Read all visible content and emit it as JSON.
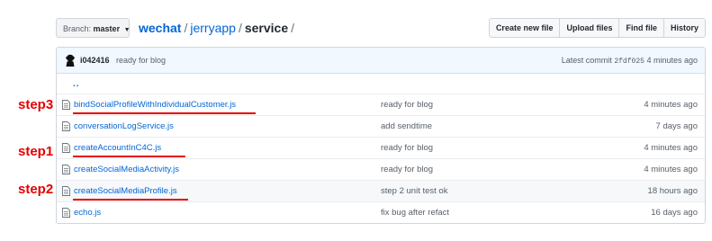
{
  "header": {
    "branch_prefix": "Branch:",
    "branch_name": "master",
    "breadcrumb": {
      "repo": "wechat",
      "folder": "jerryapp",
      "current": "service",
      "separator": "/"
    },
    "buttons": {
      "create_new_file": "Create new file",
      "upload_files": "Upload files",
      "find_file": "Find file",
      "history": "History"
    }
  },
  "commit": {
    "author": "i042416",
    "message": "ready for blog",
    "latest_prefix": "Latest commit",
    "sha": "2fdf025",
    "age": "4 minutes ago"
  },
  "updir": "..",
  "files": [
    {
      "name": "bindSocialProfileWithIndividualCustomer.js",
      "message": "ready for blog",
      "age": "4 minutes ago"
    },
    {
      "name": "conversationLogService.js",
      "message": "add sendtime",
      "age": "7 days ago"
    },
    {
      "name": "createAccountInC4C.js",
      "message": "ready for blog",
      "age": "4 minutes ago"
    },
    {
      "name": "createSocialMediaActivity.js",
      "message": "ready for blog",
      "age": "4 minutes ago"
    },
    {
      "name": "createSocialMediaProfile.js",
      "message": "step 2 unit test ok",
      "age": "18 hours ago"
    },
    {
      "name": "echo.js",
      "message": "fix bug after refact",
      "age": "16 days ago"
    }
  ],
  "annotations": {
    "step1": "step1",
    "step2": "step2",
    "step3": "step3",
    "color": "#e60000"
  },
  "colors": {
    "link": "#0366d6",
    "commit_bar": "#f1f8ff"
  },
  "icons": {
    "branch_caret": "caret-down-icon",
    "avatar": "avatar-icon",
    "file": "file-icon"
  }
}
